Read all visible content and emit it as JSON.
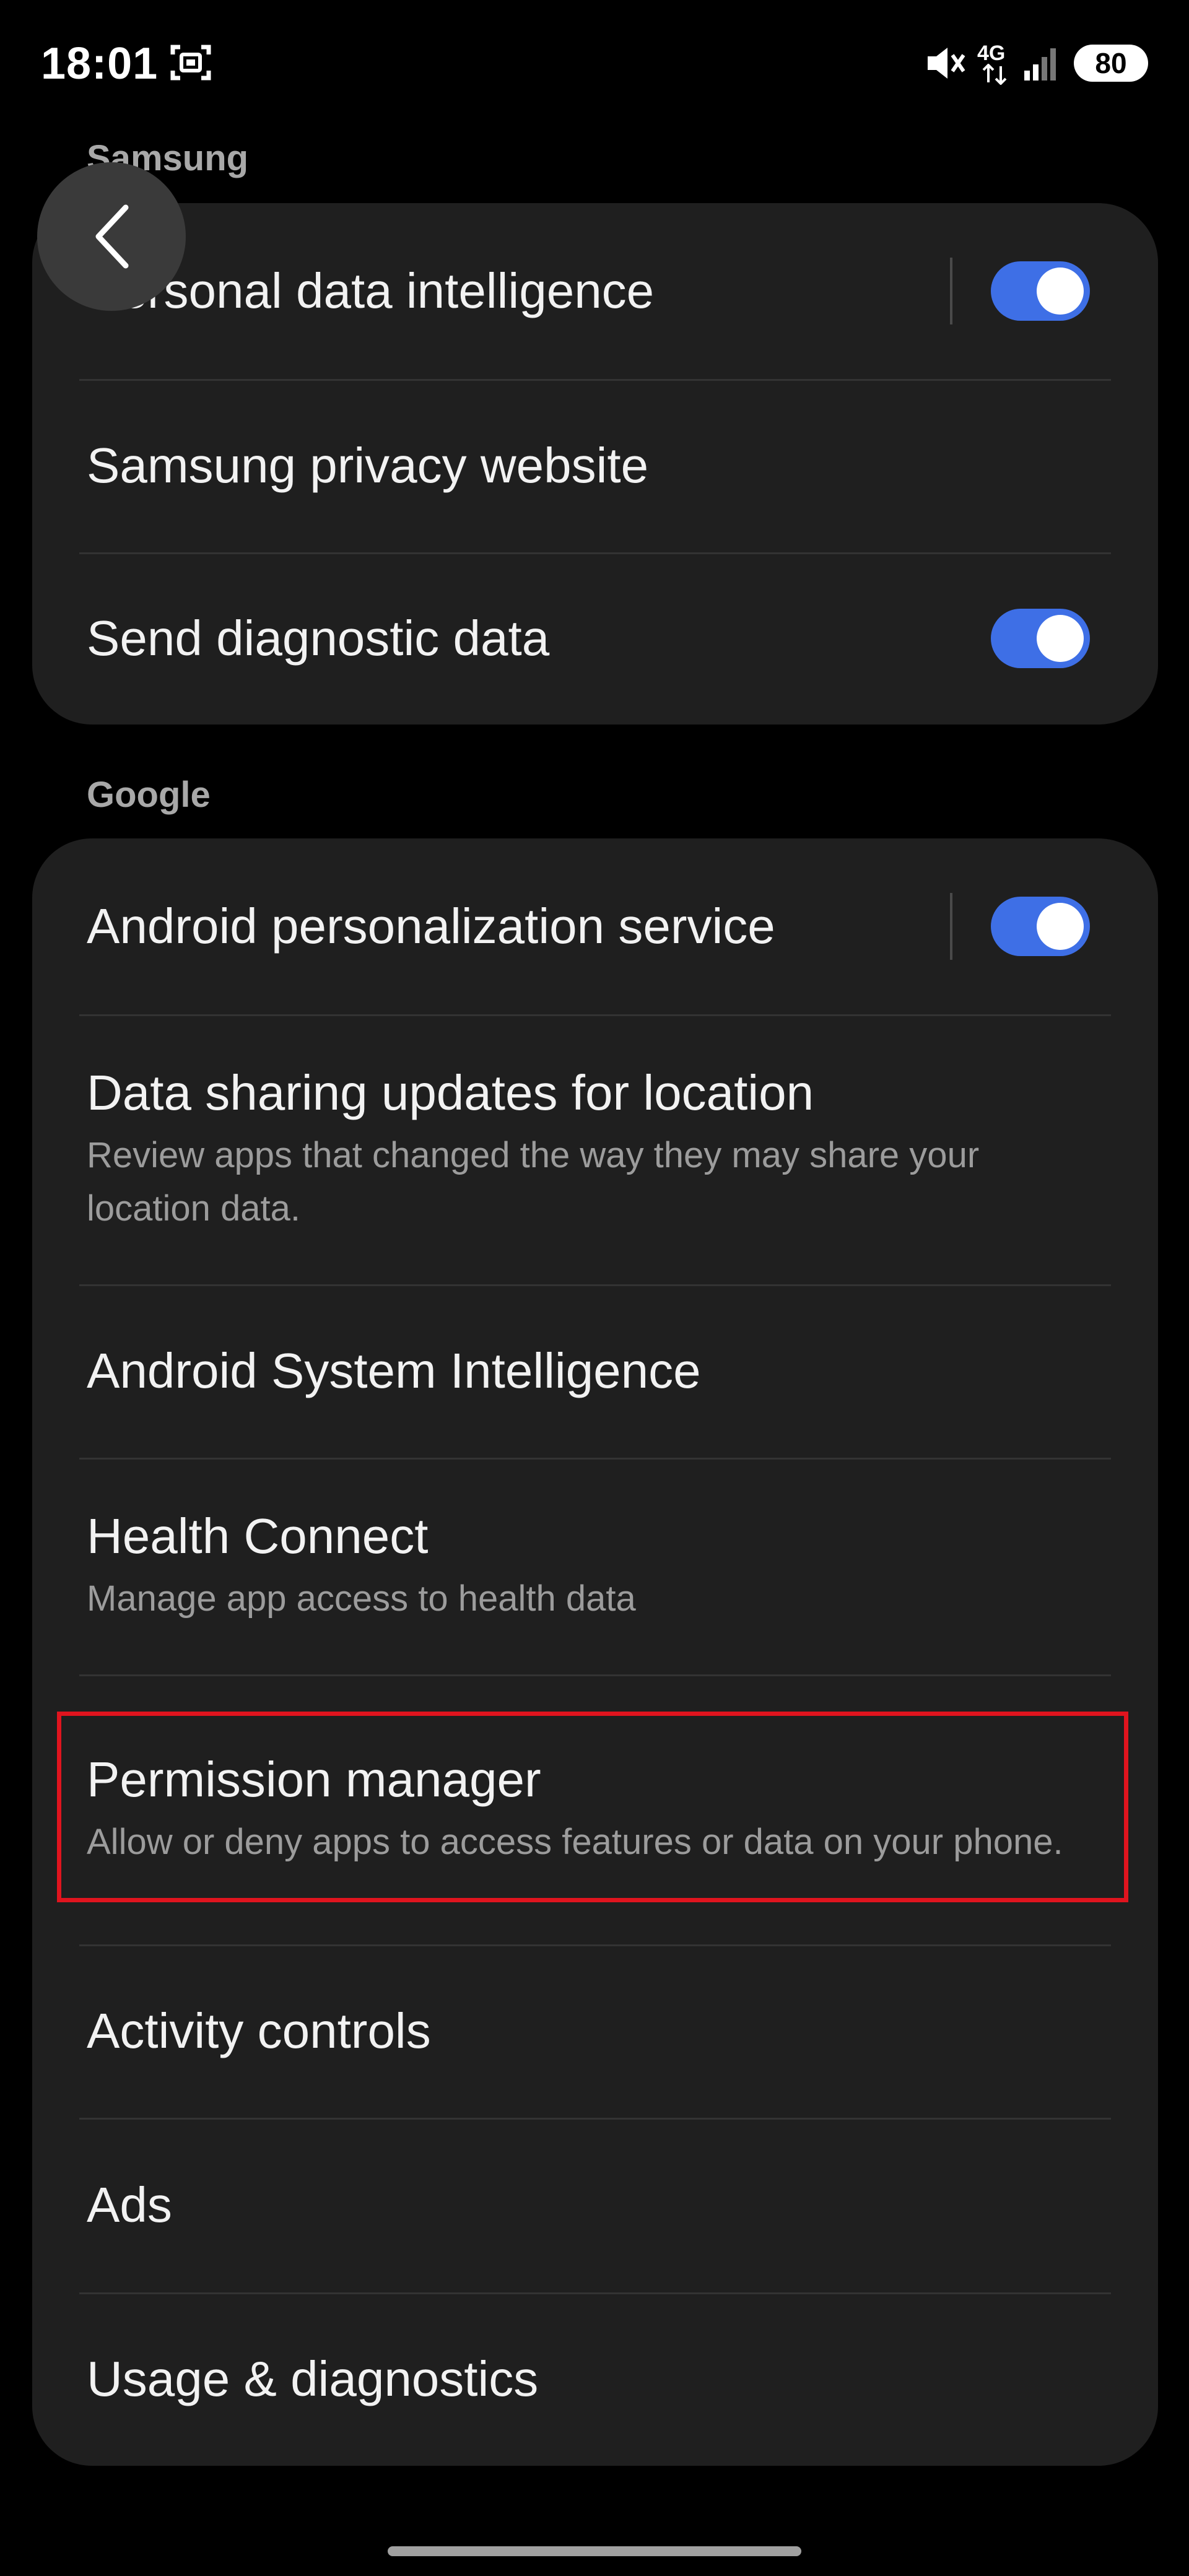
{
  "status_bar": {
    "time": "18:01",
    "network_type": "4G",
    "battery": "80",
    "icons": [
      "screenshot-icon",
      "mute-icon",
      "signal-icon"
    ]
  },
  "sections": {
    "samsung": {
      "header": "Samsung",
      "items": [
        {
          "title": "Personal data intelligence",
          "toggle": true
        },
        {
          "title": "Samsung privacy website"
        },
        {
          "title": "Send diagnostic data",
          "toggle": true
        }
      ]
    },
    "google": {
      "header": "Google",
      "items": [
        {
          "title": "Android personalization service",
          "toggle": true
        },
        {
          "title": "Data sharing updates for location",
          "subtitle": "Review apps that changed the way they may share your location data."
        },
        {
          "title": "Android System Intelligence"
        },
        {
          "title": "Health Connect",
          "subtitle": "Manage app access to health data"
        },
        {
          "title": "Permission manager",
          "subtitle": "Allow or deny apps to access features or data on your phone.",
          "highlighted": true
        },
        {
          "title": "Activity controls"
        },
        {
          "title": "Ads"
        },
        {
          "title": "Usage & diagnostics"
        }
      ]
    }
  },
  "colors": {
    "background": "#000000",
    "card": "#1f1f1f",
    "toggle_on": "#3e6fe6",
    "highlight": "#e0141e"
  }
}
